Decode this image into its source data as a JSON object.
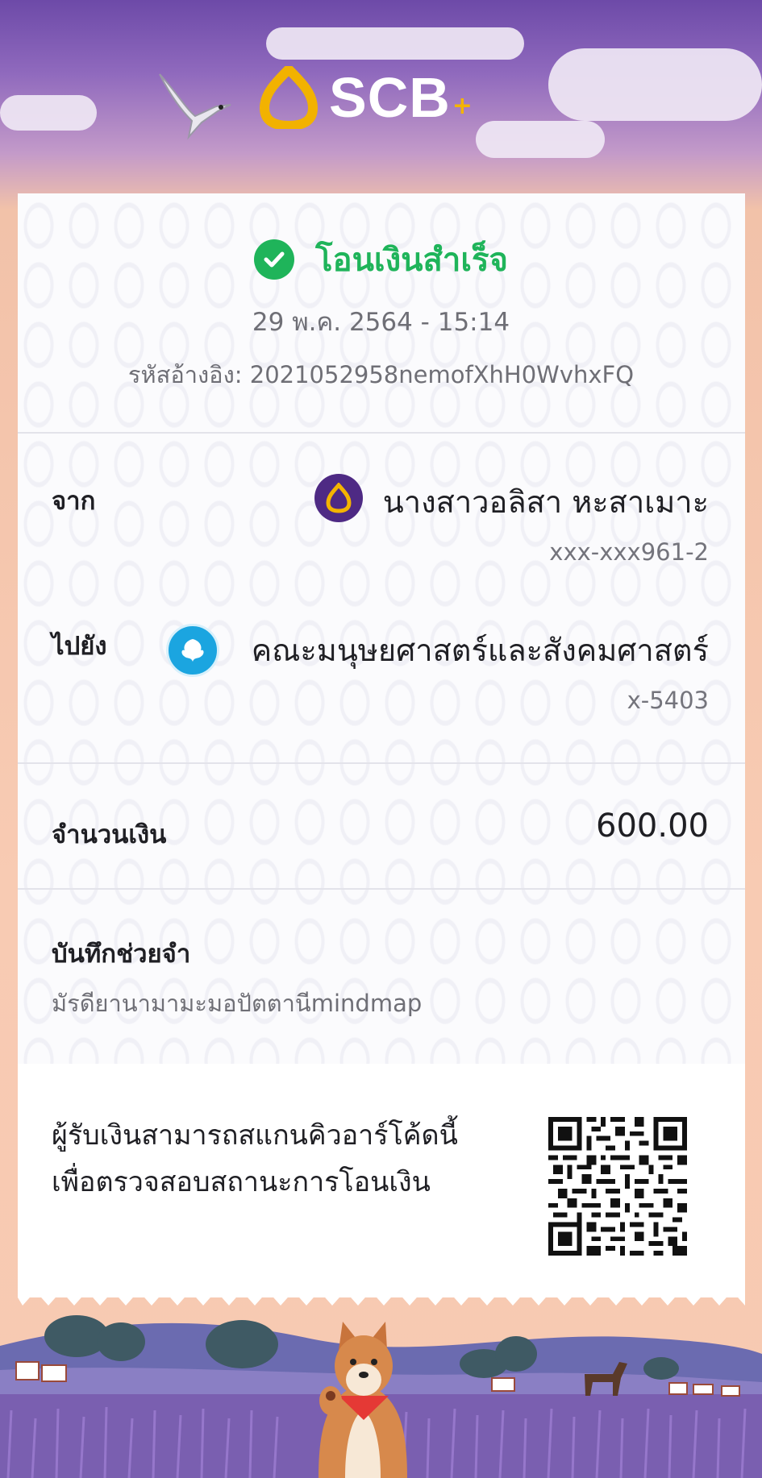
{
  "header": {
    "brand": "SCB",
    "brand_plus": "+"
  },
  "status": {
    "title": "โอนเงินสำเร็จ",
    "datetime": "29 พ.ค. 2564 - 15:14",
    "reference": "รหัสอ้างอิง: 2021052958nemofXhH0WvhxFQ"
  },
  "from": {
    "label": "จาก",
    "name": "นางสาวอลิสา หะสาเมาะ",
    "account": "xxx-xxx961-2"
  },
  "to": {
    "label": "ไปยัง",
    "name": "คณะมนุษยศาสตร์และสังคมศาสตร์",
    "account": "x-5403"
  },
  "amount": {
    "label": "จำนวนเงิน",
    "value": "600.00"
  },
  "memo": {
    "label": "บันทึกช่วยจำ",
    "text": "มัรดียานามามะมอปัตตานีmindmap"
  },
  "qr": {
    "line1": "ผู้รับเงินสามารถสแกนคิวอาร์โค้ดนี้",
    "line2": "เพื่อตรวจสอบสถานะการโอนเงิน"
  },
  "colors": {
    "success": "#1fb45a",
    "scb_purple": "#4e2a84",
    "scb_gold": "#f4b400",
    "ktb_blue": "#1ba5e0"
  },
  "icons": [
    "scb-logo-icon",
    "bird-icon",
    "check-icon",
    "scb-bank-icon",
    "ktb-bank-icon",
    "qr-code",
    "shiba-dog",
    "horse-icon"
  ]
}
